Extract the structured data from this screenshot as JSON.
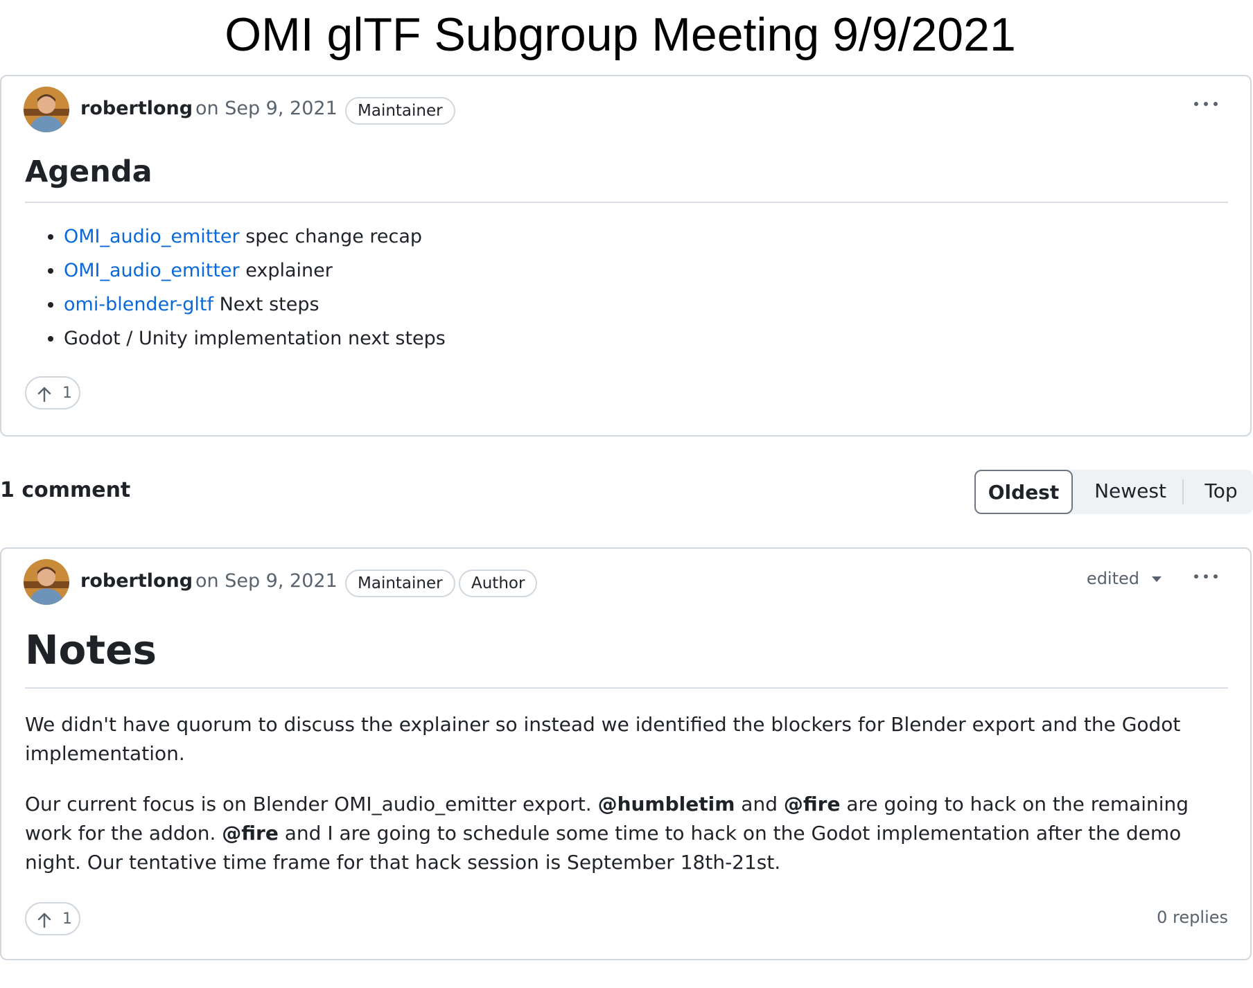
{
  "page_title": "OMI glTF Subgroup Meeting 9/9/2021",
  "post": {
    "author": "robertlong",
    "date": "on Sep 9, 2021",
    "badge": "Maintainer",
    "heading": "Agenda",
    "agenda": [
      {
        "link": "OMI_audio_emitter",
        "text": " spec change recap"
      },
      {
        "link": "OMI_audio_emitter",
        "text": " explainer"
      },
      {
        "link": "omi-blender-gltf",
        "text": " Next steps"
      },
      {
        "link": "",
        "text": "Godot / Unity implementation next steps"
      }
    ],
    "upvotes": "1"
  },
  "comments_header": {
    "count_label": "1 comment",
    "sort": {
      "oldest": "Oldest",
      "newest": "Newest",
      "top": "Top",
      "selected": "Oldest"
    }
  },
  "comment": {
    "author": "robertlong",
    "date": "on Sep 9, 2021",
    "badges": [
      "Maintainer",
      "Author"
    ],
    "edited_label": "edited",
    "heading": "Notes",
    "para1": "We didn't have quorum to discuss the explainer so instead we identified the blockers for Blender export and the Godot implementation.",
    "para2": {
      "t1": "Our current focus is on Blender OMI_audio_emitter export. ",
      "m1": "@humbletim",
      "t2": " and ",
      "m2": "@fire",
      "t3": " are going to hack on the remaining work for the addon. ",
      "m3": "@fire",
      "t4": " and I are going to schedule some time to hack on the Godot implementation after the demo night. Our tentative time frame for that hack session is September 18th-21st."
    },
    "upvotes": "1",
    "replies": "0 replies"
  },
  "colors": {
    "link": "#0969da",
    "border": "#d0d7de",
    "muted": "#59636e"
  },
  "icons": {
    "upvote": "arrow-up-icon",
    "more": "kebab-horizontal-icon",
    "avatar": "user-avatar"
  }
}
